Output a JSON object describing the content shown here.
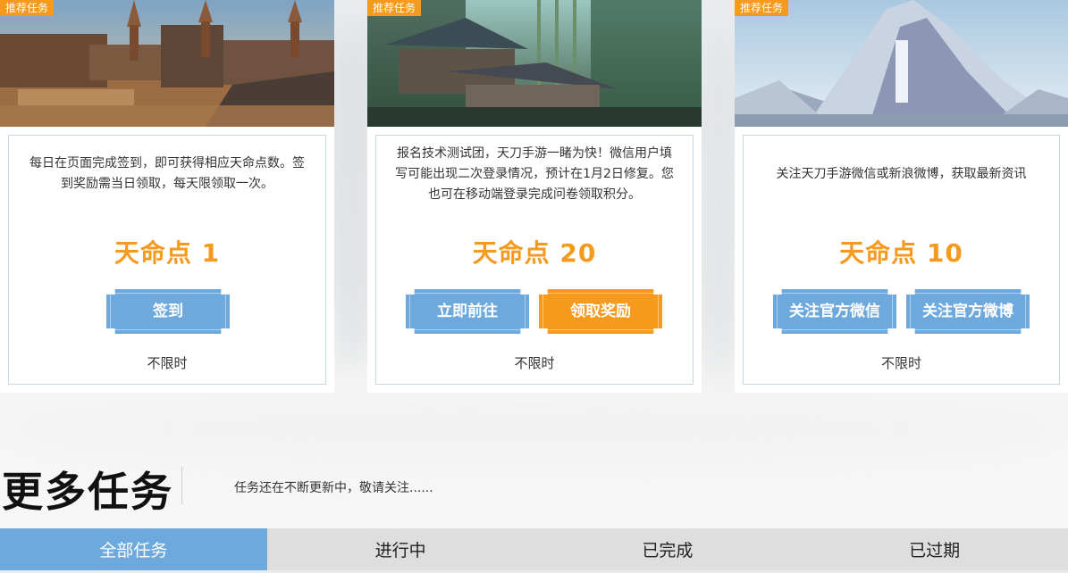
{
  "cards": [
    {
      "tag": "推荐任务",
      "desc": "每日在页面完成签到，即可获得相应天命点数。签到奖励需当日领取，每天限领取一次。",
      "points": "天命点 1",
      "buttons": [
        "签到"
      ],
      "limit": "不限时"
    },
    {
      "tag": "推荐任务",
      "desc": "报名技术测试团，天刀手游一睹为快！微信用户填写可能出现二次登录情况，预计在1月2日修复。您也可在移动端登录完成问卷领取积分。",
      "points": "天命点 20",
      "buttons": [
        "立即前往",
        "领取奖励"
      ],
      "limit": "不限时"
    },
    {
      "tag": "推荐任务",
      "desc": "关注天刀手游微信或新浪微博，获取最新资讯",
      "points": "天命点 10",
      "buttons": [
        "关注官方微信",
        "关注官方微博"
      ],
      "limit": "不限时"
    }
  ],
  "more": {
    "title": "更多任务",
    "subtitle": "任务还在不断更新中，敬请关注......"
  },
  "tabs": [
    "全部任务",
    "进行中",
    "已完成",
    "已过期"
  ],
  "colors": {
    "accent_orange": "#f59a1c",
    "accent_blue": "#6ea9de"
  }
}
